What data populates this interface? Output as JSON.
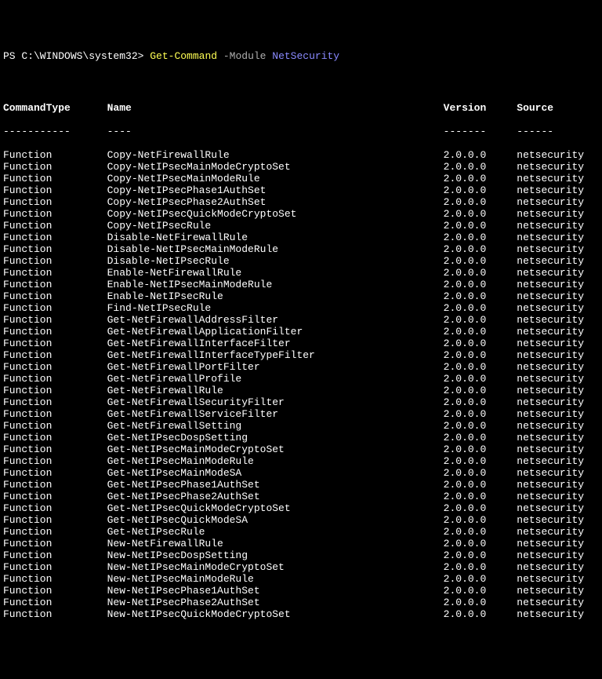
{
  "prompt": {
    "prefix": "PS C:\\WINDOWS\\system32> ",
    "command": "Get-Command",
    "param": " -Module ",
    "arg": "NetSecurity"
  },
  "headers": {
    "commandType": "CommandType",
    "name": "Name",
    "version": "Version",
    "source": "Source"
  },
  "separators": {
    "commandType": "-----------",
    "name": "----",
    "version": "-------",
    "source": "------"
  },
  "rows": [
    {
      "commandType": "Function",
      "name": "Copy-NetFirewallRule",
      "version": "2.0.0.0",
      "source": "netsecurity"
    },
    {
      "commandType": "Function",
      "name": "Copy-NetIPsecMainModeCryptoSet",
      "version": "2.0.0.0",
      "source": "netsecurity"
    },
    {
      "commandType": "Function",
      "name": "Copy-NetIPsecMainModeRule",
      "version": "2.0.0.0",
      "source": "netsecurity"
    },
    {
      "commandType": "Function",
      "name": "Copy-NetIPsecPhase1AuthSet",
      "version": "2.0.0.0",
      "source": "netsecurity"
    },
    {
      "commandType": "Function",
      "name": "Copy-NetIPsecPhase2AuthSet",
      "version": "2.0.0.0",
      "source": "netsecurity"
    },
    {
      "commandType": "Function",
      "name": "Copy-NetIPsecQuickModeCryptoSet",
      "version": "2.0.0.0",
      "source": "netsecurity"
    },
    {
      "commandType": "Function",
      "name": "Copy-NetIPsecRule",
      "version": "2.0.0.0",
      "source": "netsecurity"
    },
    {
      "commandType": "Function",
      "name": "Disable-NetFirewallRule",
      "version": "2.0.0.0",
      "source": "netsecurity"
    },
    {
      "commandType": "Function",
      "name": "Disable-NetIPsecMainModeRule",
      "version": "2.0.0.0",
      "source": "netsecurity"
    },
    {
      "commandType": "Function",
      "name": "Disable-NetIPsecRule",
      "version": "2.0.0.0",
      "source": "netsecurity"
    },
    {
      "commandType": "Function",
      "name": "Enable-NetFirewallRule",
      "version": "2.0.0.0",
      "source": "netsecurity"
    },
    {
      "commandType": "Function",
      "name": "Enable-NetIPsecMainModeRule",
      "version": "2.0.0.0",
      "source": "netsecurity"
    },
    {
      "commandType": "Function",
      "name": "Enable-NetIPsecRule",
      "version": "2.0.0.0",
      "source": "netsecurity"
    },
    {
      "commandType": "Function",
      "name": "Find-NetIPsecRule",
      "version": "2.0.0.0",
      "source": "netsecurity"
    },
    {
      "commandType": "Function",
      "name": "Get-NetFirewallAddressFilter",
      "version": "2.0.0.0",
      "source": "netsecurity"
    },
    {
      "commandType": "Function",
      "name": "Get-NetFirewallApplicationFilter",
      "version": "2.0.0.0",
      "source": "netsecurity"
    },
    {
      "commandType": "Function",
      "name": "Get-NetFirewallInterfaceFilter",
      "version": "2.0.0.0",
      "source": "netsecurity"
    },
    {
      "commandType": "Function",
      "name": "Get-NetFirewallInterfaceTypeFilter",
      "version": "2.0.0.0",
      "source": "netsecurity"
    },
    {
      "commandType": "Function",
      "name": "Get-NetFirewallPortFilter",
      "version": "2.0.0.0",
      "source": "netsecurity"
    },
    {
      "commandType": "Function",
      "name": "Get-NetFirewallProfile",
      "version": "2.0.0.0",
      "source": "netsecurity"
    },
    {
      "commandType": "Function",
      "name": "Get-NetFirewallRule",
      "version": "2.0.0.0",
      "source": "netsecurity"
    },
    {
      "commandType": "Function",
      "name": "Get-NetFirewallSecurityFilter",
      "version": "2.0.0.0",
      "source": "netsecurity"
    },
    {
      "commandType": "Function",
      "name": "Get-NetFirewallServiceFilter",
      "version": "2.0.0.0",
      "source": "netsecurity"
    },
    {
      "commandType": "Function",
      "name": "Get-NetFirewallSetting",
      "version": "2.0.0.0",
      "source": "netsecurity"
    },
    {
      "commandType": "Function",
      "name": "Get-NetIPsecDospSetting",
      "version": "2.0.0.0",
      "source": "netsecurity"
    },
    {
      "commandType": "Function",
      "name": "Get-NetIPsecMainModeCryptoSet",
      "version": "2.0.0.0",
      "source": "netsecurity"
    },
    {
      "commandType": "Function",
      "name": "Get-NetIPsecMainModeRule",
      "version": "2.0.0.0",
      "source": "netsecurity"
    },
    {
      "commandType": "Function",
      "name": "Get-NetIPsecMainModeSA",
      "version": "2.0.0.0",
      "source": "netsecurity"
    },
    {
      "commandType": "Function",
      "name": "Get-NetIPsecPhase1AuthSet",
      "version": "2.0.0.0",
      "source": "netsecurity"
    },
    {
      "commandType": "Function",
      "name": "Get-NetIPsecPhase2AuthSet",
      "version": "2.0.0.0",
      "source": "netsecurity"
    },
    {
      "commandType": "Function",
      "name": "Get-NetIPsecQuickModeCryptoSet",
      "version": "2.0.0.0",
      "source": "netsecurity"
    },
    {
      "commandType": "Function",
      "name": "Get-NetIPsecQuickModeSA",
      "version": "2.0.0.0",
      "source": "netsecurity"
    },
    {
      "commandType": "Function",
      "name": "Get-NetIPsecRule",
      "version": "2.0.0.0",
      "source": "netsecurity"
    },
    {
      "commandType": "Function",
      "name": "New-NetFirewallRule",
      "version": "2.0.0.0",
      "source": "netsecurity"
    },
    {
      "commandType": "Function",
      "name": "New-NetIPsecDospSetting",
      "version": "2.0.0.0",
      "source": "netsecurity"
    },
    {
      "commandType": "Function",
      "name": "New-NetIPsecMainModeCryptoSet",
      "version": "2.0.0.0",
      "source": "netsecurity"
    },
    {
      "commandType": "Function",
      "name": "New-NetIPsecMainModeRule",
      "version": "2.0.0.0",
      "source": "netsecurity"
    },
    {
      "commandType": "Function",
      "name": "New-NetIPsecPhase1AuthSet",
      "version": "2.0.0.0",
      "source": "netsecurity"
    },
    {
      "commandType": "Function",
      "name": "New-NetIPsecPhase2AuthSet",
      "version": "2.0.0.0",
      "source": "netsecurity"
    },
    {
      "commandType": "Function",
      "name": "New-NetIPsecQuickModeCryptoSet",
      "version": "2.0.0.0",
      "source": "netsecurity"
    }
  ]
}
